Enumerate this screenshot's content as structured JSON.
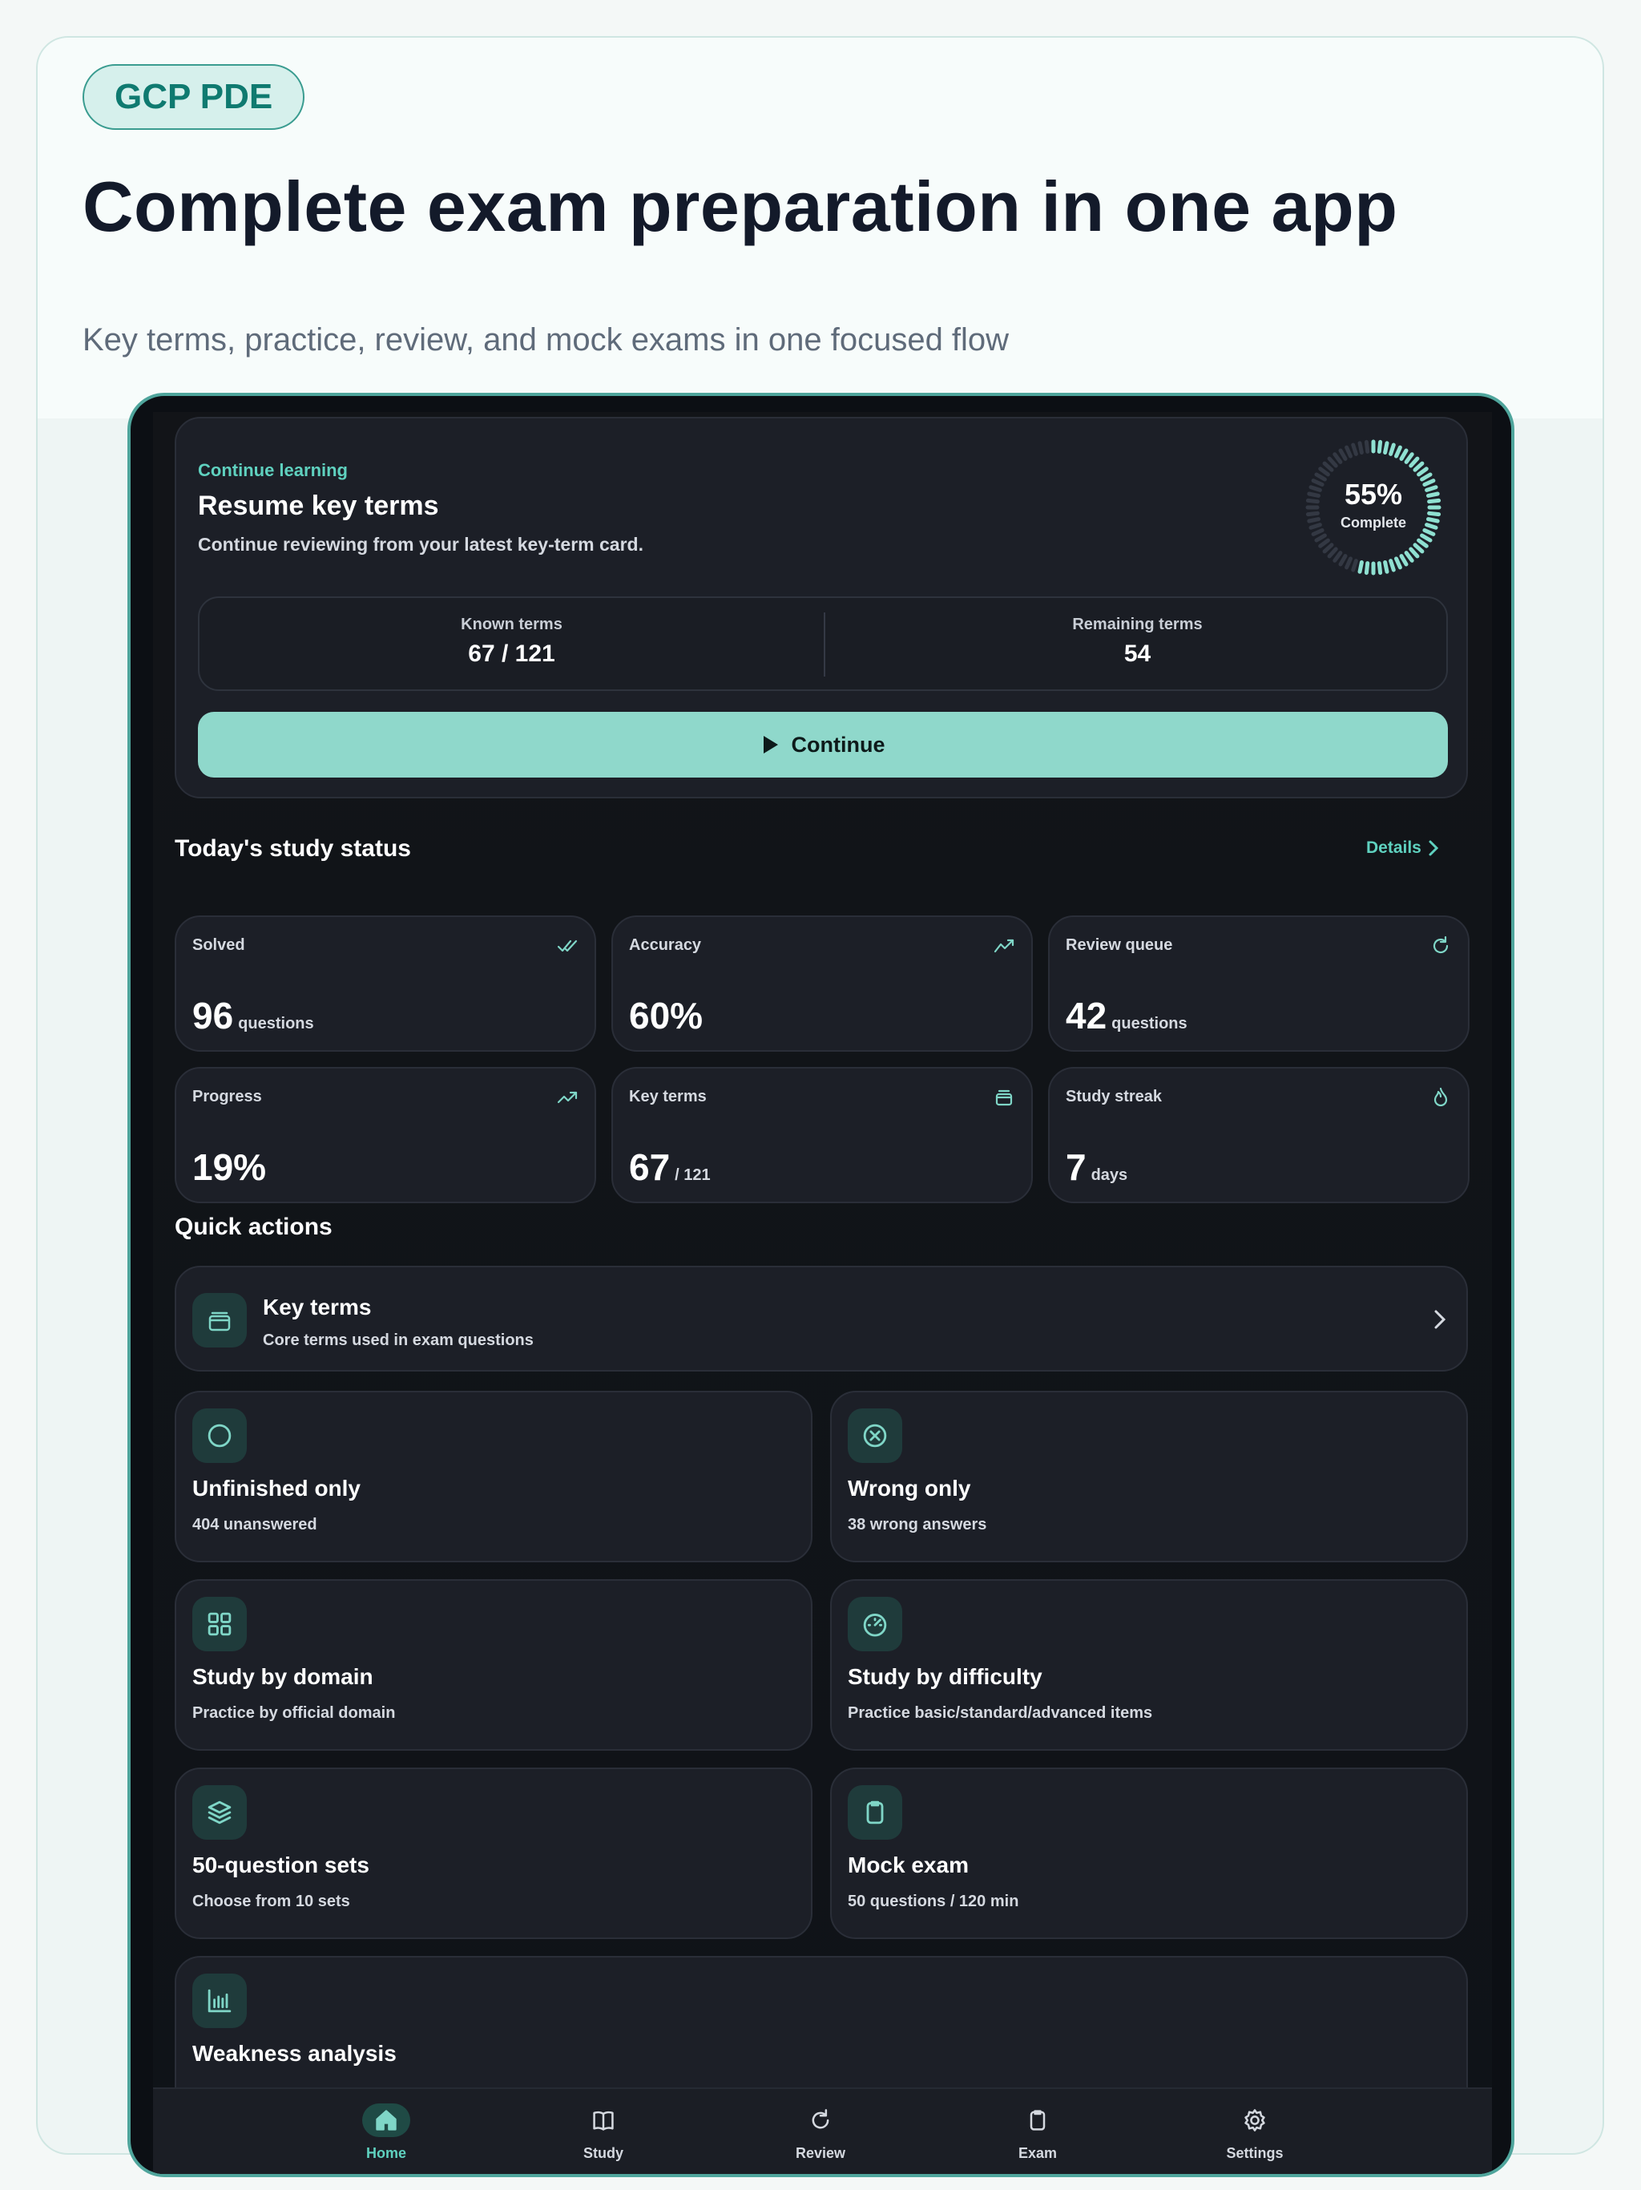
{
  "hero": {
    "badge": "GCP PDE",
    "headline": "Complete exam preparation in one app",
    "subline": "Key terms, practice, review, and mock exams in one focused flow"
  },
  "continue_card": {
    "eyebrow": "Continue learning",
    "title": "Resume key terms",
    "subtitle": "Continue reviewing from your latest key-term card.",
    "ring_percent": "55%",
    "ring_label": "Complete",
    "ring_fraction": 0.55,
    "known_label": "Known terms",
    "known_value": "67 / 121",
    "remaining_label": "Remaining terms",
    "remaining_value": "54",
    "button_label": "Continue"
  },
  "status": {
    "title": "Today's study status",
    "details_label": "Details",
    "cards": [
      {
        "label": "Solved",
        "value": "96",
        "unit": "questions",
        "icon": "double-check-icon"
      },
      {
        "label": "Accuracy",
        "value": "60%",
        "unit": "",
        "icon": "trend-line-icon"
      },
      {
        "label": "Review queue",
        "value": "42",
        "unit": "questions",
        "icon": "refresh-icon"
      },
      {
        "label": "Progress",
        "value": "19%",
        "unit": "",
        "icon": "trending-up-icon"
      },
      {
        "label": "Key terms",
        "value": "67",
        "unit": "/ 121",
        "icon": "card-stack-icon"
      },
      {
        "label": "Study streak",
        "value": "7",
        "unit": "days",
        "icon": "flame-icon"
      }
    ]
  },
  "quick_actions": {
    "title": "Quick actions",
    "key_terms": {
      "title": "Key terms",
      "subtitle": "Core terms used in exam questions"
    },
    "items": [
      {
        "title": "Unfinished only",
        "subtitle": "404 unanswered",
        "icon": "circle-icon"
      },
      {
        "title": "Wrong only",
        "subtitle": "38 wrong answers",
        "icon": "x-circle-icon"
      },
      {
        "title": "Study by domain",
        "subtitle": "Practice by official domain",
        "icon": "grid-icon"
      },
      {
        "title": "Study by difficulty",
        "subtitle": "Practice basic/standard/advanced items",
        "icon": "gauge-icon"
      },
      {
        "title": "50-question sets",
        "subtitle": "Choose from 10 sets",
        "icon": "layers-icon"
      },
      {
        "title": "Mock exam",
        "subtitle": "50 questions / 120 min",
        "icon": "clipboard-icon"
      },
      {
        "title": "Weakness analysis",
        "subtitle": "",
        "icon": "bar-chart-icon"
      }
    ]
  },
  "nav": {
    "items": [
      {
        "label": "Home",
        "icon": "home-icon",
        "active": true
      },
      {
        "label": "Study",
        "icon": "book-icon",
        "active": false
      },
      {
        "label": "Review",
        "icon": "refresh-icon",
        "active": false
      },
      {
        "label": "Exam",
        "icon": "clipboard-icon",
        "active": false
      },
      {
        "label": "Settings",
        "icon": "gear-icon",
        "active": false
      }
    ]
  },
  "colors": {
    "accent": "#5fd1bf",
    "button": "#8fd8cb",
    "card": "#1c1f27",
    "screen": "#121418"
  }
}
